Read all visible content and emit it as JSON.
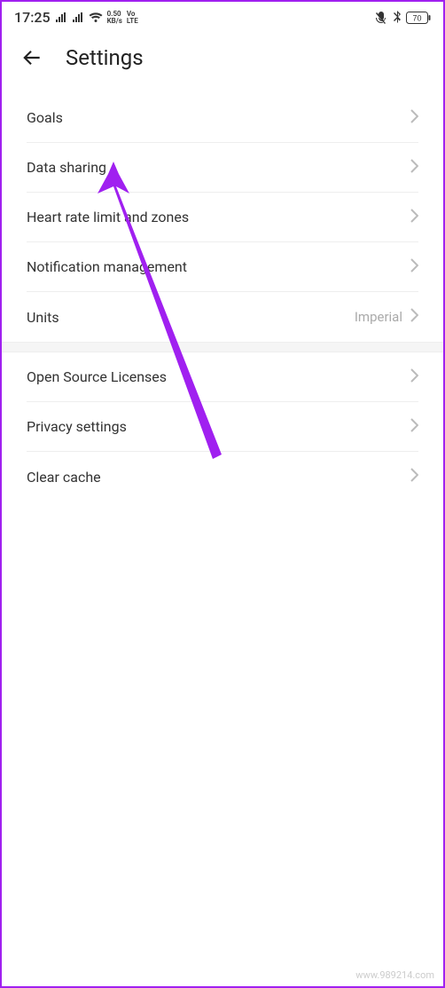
{
  "status": {
    "time": "17:25",
    "kb_label": "0.50\nKB/s",
    "lte_label": "Vo\nLTE",
    "battery_pct": "70"
  },
  "header": {
    "title": "Settings"
  },
  "group1": [
    {
      "label": "Goals"
    },
    {
      "label": "Data sharing"
    },
    {
      "label": "Heart rate limit and zones"
    },
    {
      "label": "Notification management"
    },
    {
      "label": "Units",
      "value": "Imperial"
    }
  ],
  "group2": [
    {
      "label": "Open Source Licenses"
    },
    {
      "label": "Privacy settings"
    },
    {
      "label": "Clear cache"
    }
  ],
  "watermark": "www.989214.com"
}
